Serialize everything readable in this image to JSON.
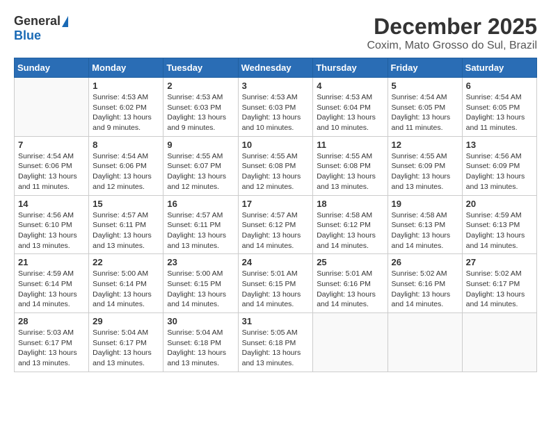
{
  "header": {
    "logo_general": "General",
    "logo_blue": "Blue",
    "month_title": "December 2025",
    "location": "Coxim, Mato Grosso do Sul, Brazil"
  },
  "days_of_week": [
    "Sunday",
    "Monday",
    "Tuesday",
    "Wednesday",
    "Thursday",
    "Friday",
    "Saturday"
  ],
  "weeks": [
    [
      {
        "day": "",
        "info": ""
      },
      {
        "day": "1",
        "info": "Sunrise: 4:53 AM\nSunset: 6:02 PM\nDaylight: 13 hours\nand 9 minutes."
      },
      {
        "day": "2",
        "info": "Sunrise: 4:53 AM\nSunset: 6:03 PM\nDaylight: 13 hours\nand 9 minutes."
      },
      {
        "day": "3",
        "info": "Sunrise: 4:53 AM\nSunset: 6:03 PM\nDaylight: 13 hours\nand 10 minutes."
      },
      {
        "day": "4",
        "info": "Sunrise: 4:53 AM\nSunset: 6:04 PM\nDaylight: 13 hours\nand 10 minutes."
      },
      {
        "day": "5",
        "info": "Sunrise: 4:54 AM\nSunset: 6:05 PM\nDaylight: 13 hours\nand 11 minutes."
      },
      {
        "day": "6",
        "info": "Sunrise: 4:54 AM\nSunset: 6:05 PM\nDaylight: 13 hours\nand 11 minutes."
      }
    ],
    [
      {
        "day": "7",
        "info": "Sunrise: 4:54 AM\nSunset: 6:06 PM\nDaylight: 13 hours\nand 11 minutes."
      },
      {
        "day": "8",
        "info": "Sunrise: 4:54 AM\nSunset: 6:06 PM\nDaylight: 13 hours\nand 12 minutes."
      },
      {
        "day": "9",
        "info": "Sunrise: 4:55 AM\nSunset: 6:07 PM\nDaylight: 13 hours\nand 12 minutes."
      },
      {
        "day": "10",
        "info": "Sunrise: 4:55 AM\nSunset: 6:08 PM\nDaylight: 13 hours\nand 12 minutes."
      },
      {
        "day": "11",
        "info": "Sunrise: 4:55 AM\nSunset: 6:08 PM\nDaylight: 13 hours\nand 13 minutes."
      },
      {
        "day": "12",
        "info": "Sunrise: 4:55 AM\nSunset: 6:09 PM\nDaylight: 13 hours\nand 13 minutes."
      },
      {
        "day": "13",
        "info": "Sunrise: 4:56 AM\nSunset: 6:09 PM\nDaylight: 13 hours\nand 13 minutes."
      }
    ],
    [
      {
        "day": "14",
        "info": "Sunrise: 4:56 AM\nSunset: 6:10 PM\nDaylight: 13 hours\nand 13 minutes."
      },
      {
        "day": "15",
        "info": "Sunrise: 4:57 AM\nSunset: 6:11 PM\nDaylight: 13 hours\nand 13 minutes."
      },
      {
        "day": "16",
        "info": "Sunrise: 4:57 AM\nSunset: 6:11 PM\nDaylight: 13 hours\nand 13 minutes."
      },
      {
        "day": "17",
        "info": "Sunrise: 4:57 AM\nSunset: 6:12 PM\nDaylight: 13 hours\nand 14 minutes."
      },
      {
        "day": "18",
        "info": "Sunrise: 4:58 AM\nSunset: 6:12 PM\nDaylight: 13 hours\nand 14 minutes."
      },
      {
        "day": "19",
        "info": "Sunrise: 4:58 AM\nSunset: 6:13 PM\nDaylight: 13 hours\nand 14 minutes."
      },
      {
        "day": "20",
        "info": "Sunrise: 4:59 AM\nSunset: 6:13 PM\nDaylight: 13 hours\nand 14 minutes."
      }
    ],
    [
      {
        "day": "21",
        "info": "Sunrise: 4:59 AM\nSunset: 6:14 PM\nDaylight: 13 hours\nand 14 minutes."
      },
      {
        "day": "22",
        "info": "Sunrise: 5:00 AM\nSunset: 6:14 PM\nDaylight: 13 hours\nand 14 minutes."
      },
      {
        "day": "23",
        "info": "Sunrise: 5:00 AM\nSunset: 6:15 PM\nDaylight: 13 hours\nand 14 minutes."
      },
      {
        "day": "24",
        "info": "Sunrise: 5:01 AM\nSunset: 6:15 PM\nDaylight: 13 hours\nand 14 minutes."
      },
      {
        "day": "25",
        "info": "Sunrise: 5:01 AM\nSunset: 6:16 PM\nDaylight: 13 hours\nand 14 minutes."
      },
      {
        "day": "26",
        "info": "Sunrise: 5:02 AM\nSunset: 6:16 PM\nDaylight: 13 hours\nand 14 minutes."
      },
      {
        "day": "27",
        "info": "Sunrise: 5:02 AM\nSunset: 6:17 PM\nDaylight: 13 hours\nand 14 minutes."
      }
    ],
    [
      {
        "day": "28",
        "info": "Sunrise: 5:03 AM\nSunset: 6:17 PM\nDaylight: 13 hours\nand 13 minutes."
      },
      {
        "day": "29",
        "info": "Sunrise: 5:04 AM\nSunset: 6:17 PM\nDaylight: 13 hours\nand 13 minutes."
      },
      {
        "day": "30",
        "info": "Sunrise: 5:04 AM\nSunset: 6:18 PM\nDaylight: 13 hours\nand 13 minutes."
      },
      {
        "day": "31",
        "info": "Sunrise: 5:05 AM\nSunset: 6:18 PM\nDaylight: 13 hours\nand 13 minutes."
      },
      {
        "day": "",
        "info": ""
      },
      {
        "day": "",
        "info": ""
      },
      {
        "day": "",
        "info": ""
      }
    ]
  ]
}
